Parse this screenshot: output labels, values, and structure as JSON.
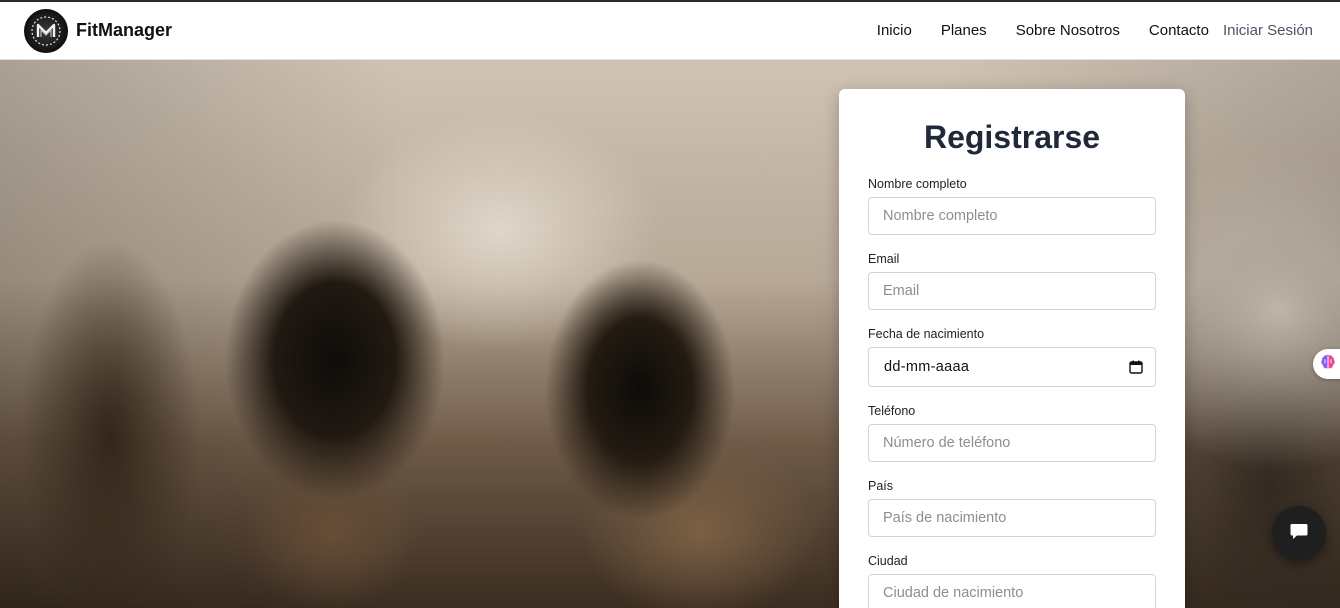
{
  "header": {
    "brand_name": "FitManager",
    "logo_icon": "fitmanager-logo",
    "nav": [
      {
        "label": "Inicio"
      },
      {
        "label": "Planes"
      },
      {
        "label": "Sobre Nosotros"
      },
      {
        "label": "Contacto"
      }
    ],
    "login_label": "Iniciar Sesión"
  },
  "form": {
    "title": "Registrarse",
    "fields": [
      {
        "label": "Nombre completo",
        "placeholder": "Nombre completo",
        "value": ""
      },
      {
        "label": "Email",
        "placeholder": "Email",
        "value": ""
      },
      {
        "label": "Fecha de nacimiento",
        "value": "dd-mm-aaaa"
      },
      {
        "label": "Teléfono",
        "placeholder": "Número de teléfono",
        "value": ""
      },
      {
        "label": "País",
        "placeholder": "País de nacimiento",
        "value": ""
      },
      {
        "label": "Ciudad",
        "placeholder": "Ciudad de nacimiento",
        "value": ""
      }
    ]
  },
  "widgets": {
    "side_icon": "brain-icon",
    "chat_icon": "chat-bubble-icon"
  },
  "colors": {
    "title": "#1f2937",
    "header_bg": "#ffffff",
    "chat_button": "#1f1f1f",
    "input_border": "#cfd4da"
  }
}
